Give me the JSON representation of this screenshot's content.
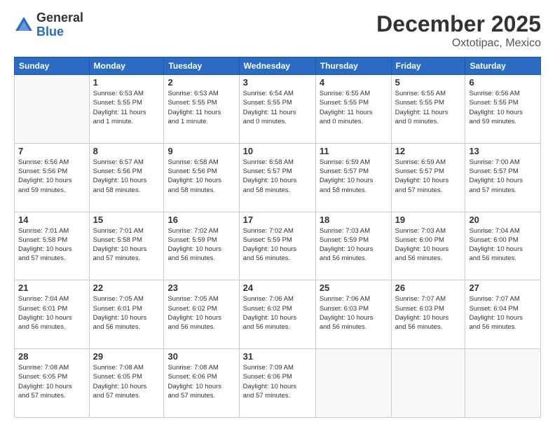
{
  "logo": {
    "general": "General",
    "blue": "Blue"
  },
  "header": {
    "month": "December 2025",
    "location": "Oxtotipac, Mexico"
  },
  "days_of_week": [
    "Sunday",
    "Monday",
    "Tuesday",
    "Wednesday",
    "Thursday",
    "Friday",
    "Saturday"
  ],
  "weeks": [
    [
      {
        "day": "",
        "info": ""
      },
      {
        "day": "1",
        "info": "Sunrise: 6:53 AM\nSunset: 5:55 PM\nDaylight: 11 hours\nand 1 minute."
      },
      {
        "day": "2",
        "info": "Sunrise: 6:53 AM\nSunset: 5:55 PM\nDaylight: 11 hours\nand 1 minute."
      },
      {
        "day": "3",
        "info": "Sunrise: 6:54 AM\nSunset: 5:55 PM\nDaylight: 11 hours\nand 0 minutes."
      },
      {
        "day": "4",
        "info": "Sunrise: 6:55 AM\nSunset: 5:55 PM\nDaylight: 11 hours\nand 0 minutes."
      },
      {
        "day": "5",
        "info": "Sunrise: 6:55 AM\nSunset: 5:55 PM\nDaylight: 11 hours\nand 0 minutes."
      },
      {
        "day": "6",
        "info": "Sunrise: 6:56 AM\nSunset: 5:55 PM\nDaylight: 10 hours\nand 59 minutes."
      }
    ],
    [
      {
        "day": "7",
        "info": "Sunrise: 6:56 AM\nSunset: 5:56 PM\nDaylight: 10 hours\nand 59 minutes."
      },
      {
        "day": "8",
        "info": "Sunrise: 6:57 AM\nSunset: 5:56 PM\nDaylight: 10 hours\nand 58 minutes."
      },
      {
        "day": "9",
        "info": "Sunrise: 6:58 AM\nSunset: 5:56 PM\nDaylight: 10 hours\nand 58 minutes."
      },
      {
        "day": "10",
        "info": "Sunrise: 6:58 AM\nSunset: 5:57 PM\nDaylight: 10 hours\nand 58 minutes."
      },
      {
        "day": "11",
        "info": "Sunrise: 6:59 AM\nSunset: 5:57 PM\nDaylight: 10 hours\nand 58 minutes."
      },
      {
        "day": "12",
        "info": "Sunrise: 6:59 AM\nSunset: 5:57 PM\nDaylight: 10 hours\nand 57 minutes."
      },
      {
        "day": "13",
        "info": "Sunrise: 7:00 AM\nSunset: 5:57 PM\nDaylight: 10 hours\nand 57 minutes."
      }
    ],
    [
      {
        "day": "14",
        "info": "Sunrise: 7:01 AM\nSunset: 5:58 PM\nDaylight: 10 hours\nand 57 minutes."
      },
      {
        "day": "15",
        "info": "Sunrise: 7:01 AM\nSunset: 5:58 PM\nDaylight: 10 hours\nand 57 minutes."
      },
      {
        "day": "16",
        "info": "Sunrise: 7:02 AM\nSunset: 5:59 PM\nDaylight: 10 hours\nand 56 minutes."
      },
      {
        "day": "17",
        "info": "Sunrise: 7:02 AM\nSunset: 5:59 PM\nDaylight: 10 hours\nand 56 minutes."
      },
      {
        "day": "18",
        "info": "Sunrise: 7:03 AM\nSunset: 5:59 PM\nDaylight: 10 hours\nand 56 minutes."
      },
      {
        "day": "19",
        "info": "Sunrise: 7:03 AM\nSunset: 6:00 PM\nDaylight: 10 hours\nand 56 minutes."
      },
      {
        "day": "20",
        "info": "Sunrise: 7:04 AM\nSunset: 6:00 PM\nDaylight: 10 hours\nand 56 minutes."
      }
    ],
    [
      {
        "day": "21",
        "info": "Sunrise: 7:04 AM\nSunset: 6:01 PM\nDaylight: 10 hours\nand 56 minutes."
      },
      {
        "day": "22",
        "info": "Sunrise: 7:05 AM\nSunset: 6:01 PM\nDaylight: 10 hours\nand 56 minutes."
      },
      {
        "day": "23",
        "info": "Sunrise: 7:05 AM\nSunset: 6:02 PM\nDaylight: 10 hours\nand 56 minutes."
      },
      {
        "day": "24",
        "info": "Sunrise: 7:06 AM\nSunset: 6:02 PM\nDaylight: 10 hours\nand 56 minutes."
      },
      {
        "day": "25",
        "info": "Sunrise: 7:06 AM\nSunset: 6:03 PM\nDaylight: 10 hours\nand 56 minutes."
      },
      {
        "day": "26",
        "info": "Sunrise: 7:07 AM\nSunset: 6:03 PM\nDaylight: 10 hours\nand 56 minutes."
      },
      {
        "day": "27",
        "info": "Sunrise: 7:07 AM\nSunset: 6:04 PM\nDaylight: 10 hours\nand 56 minutes."
      }
    ],
    [
      {
        "day": "28",
        "info": "Sunrise: 7:08 AM\nSunset: 6:05 PM\nDaylight: 10 hours\nand 57 minutes."
      },
      {
        "day": "29",
        "info": "Sunrise: 7:08 AM\nSunset: 6:05 PM\nDaylight: 10 hours\nand 57 minutes."
      },
      {
        "day": "30",
        "info": "Sunrise: 7:08 AM\nSunset: 6:06 PM\nDaylight: 10 hours\nand 57 minutes."
      },
      {
        "day": "31",
        "info": "Sunrise: 7:09 AM\nSunset: 6:06 PM\nDaylight: 10 hours\nand 57 minutes."
      },
      {
        "day": "",
        "info": ""
      },
      {
        "day": "",
        "info": ""
      },
      {
        "day": "",
        "info": ""
      }
    ]
  ]
}
